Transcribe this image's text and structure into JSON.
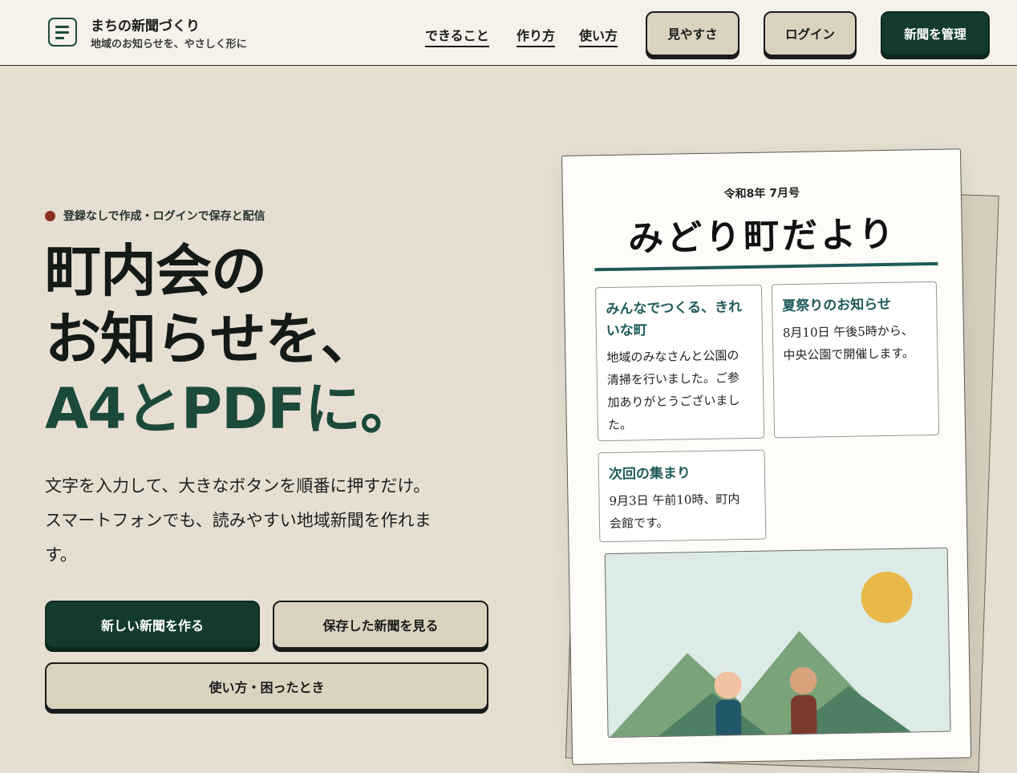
{
  "header": {
    "brand_title": "まちの新聞づくり",
    "brand_subtitle": "地域のお知らせを、やさしく形に",
    "nav": [
      "できること",
      "作り方",
      "使い方"
    ],
    "buttons": {
      "accessibility": "見やすさ",
      "login": "ログイン",
      "manage": "新聞を管理"
    }
  },
  "hero": {
    "badge": "登録なしで作成・ログインで保存と配信",
    "headline_1": "町内会の",
    "headline_2": "お知らせを、",
    "headline_3": "A4とPDFに。",
    "lead_1": "文字を入力して、大きなボタンを順番に押すだけ。",
    "lead_2": "スマートフォンでも、読みやすい地域新聞を作れま",
    "lead_3": "す。",
    "cta_new": "新しい新聞を作る",
    "cta_saved": "保存した新聞を見る",
    "cta_help": "使い方・困ったとき"
  },
  "paper": {
    "issue": "令和8年 7月号",
    "title": "みどり町だより",
    "cards": [
      {
        "heading_1": "みんなでつくる、きれ",
        "heading_2": "いな町",
        "body_1": "地域のみなさんと公園の",
        "body_2": "清掃を行いました。ご参",
        "body_3": "加ありがとうございまし",
        "body_4": "た。"
      },
      {
        "heading_1": "夏祭りのお知らせ",
        "body_1": "8月10日 午後5時から、",
        "body_2": "中央公園で開催します。"
      },
      {
        "heading_1": "次回の集まり",
        "body_1": "9月3日 午前10時、町内",
        "body_2": "会館です。"
      }
    ]
  },
  "colors": {
    "accent": "#123b2e",
    "background": "#e6dfd1",
    "badge_dot": "#8a2e22",
    "paper_rule": "#1e5a58"
  },
  "icons": {
    "logo": "newspaper-lines-icon"
  }
}
